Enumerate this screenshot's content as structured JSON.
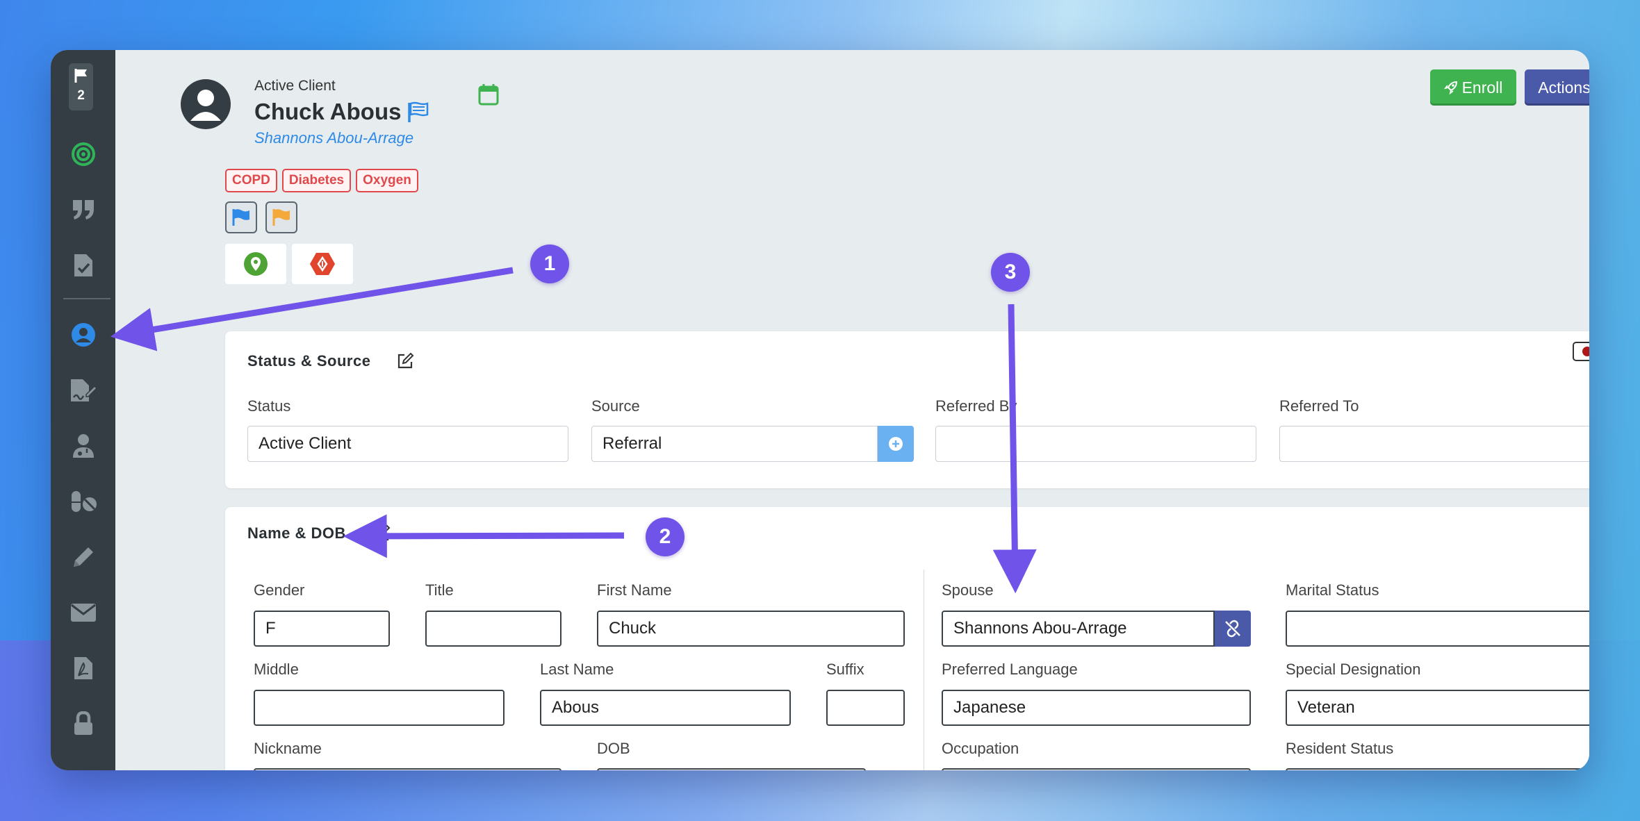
{
  "sidebar": {
    "flag_count": "2",
    "items": [
      {
        "icon": "target-icon",
        "color": "#2fb45a"
      },
      {
        "icon": "quote-icon"
      },
      {
        "icon": "file-check-icon"
      },
      {
        "icon": "user-circle-icon",
        "active": true,
        "color": "#2e8ae6"
      },
      {
        "icon": "file-signature-icon"
      },
      {
        "icon": "user-doctor-icon"
      },
      {
        "icon": "pills-icon"
      },
      {
        "icon": "pencil-icon"
      },
      {
        "icon": "envelope-icon"
      },
      {
        "icon": "file-pdf-icon"
      },
      {
        "icon": "lock-icon"
      }
    ]
  },
  "header": {
    "status": "Active Client",
    "name": "Chuck Abous",
    "spouse_link": "Shannons Abou-Arrage",
    "enroll_label": "Enroll",
    "actions_label": "Actions"
  },
  "tags": [
    "COPD",
    "Diabetes",
    "Oxygen"
  ],
  "status_source": {
    "title": "Status & Source",
    "fields": {
      "status": {
        "label": "Status",
        "value": "Active Client"
      },
      "source": {
        "label": "Source",
        "value": "Referral"
      },
      "referred_by": {
        "label": "Referred By",
        "value": ""
      },
      "referred_to": {
        "label": "Referred To",
        "value": ""
      }
    }
  },
  "name_dob": {
    "title": "Name & DOB",
    "fields": {
      "gender": {
        "label": "Gender",
        "value": "F"
      },
      "title": {
        "label": "Title",
        "value": ""
      },
      "first_name": {
        "label": "First Name",
        "value": "Chuck"
      },
      "middle": {
        "label": "Middle",
        "value": ""
      },
      "last_name": {
        "label": "Last Name",
        "value": "Abous"
      },
      "suffix": {
        "label": "Suffix",
        "value": ""
      },
      "nickname": {
        "label": "Nickname"
      },
      "dob": {
        "label": "DOB"
      },
      "spouse": {
        "label": "Spouse",
        "value": "Shannons Abou-Arrage"
      },
      "marital_status": {
        "label": "Marital Status",
        "value": ""
      },
      "preferred_language": {
        "label": "Preferred Language",
        "value": "Japanese"
      },
      "special_designation": {
        "label": "Special Designation",
        "value": "Veteran"
      },
      "occupation": {
        "label": "Occupation"
      },
      "resident_status": {
        "label": "Resident Status"
      }
    }
  },
  "annotations": [
    "1",
    "2",
    "3"
  ],
  "colors": {
    "sidebar_bg": "#343d43",
    "accent_blue": "#2e8ae6",
    "enroll_green": "#3fb34f",
    "actions_indigo": "#4b5aa8",
    "tag_red": "#e0494c",
    "annotation_purple": "#7053e8"
  }
}
